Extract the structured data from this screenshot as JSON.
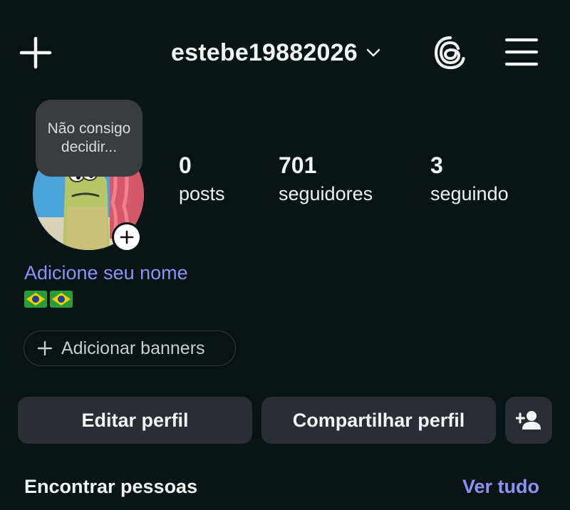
{
  "header": {
    "username": "estebe19882026",
    "icons": {
      "create": "plus-icon",
      "account_switch": "chevron-down-icon",
      "threads": "threads-icon",
      "menu": "hamburger-menu-icon"
    }
  },
  "profile": {
    "note": "Não consigo decidir...",
    "avatar_add_icon": "plus-icon",
    "stats": [
      {
        "count": "0",
        "label": "posts"
      },
      {
        "count": "701",
        "label": "seguidores"
      },
      {
        "count": "3",
        "label": "seguindo"
      }
    ],
    "add_name": "Adicione seu nome",
    "bio_emojis": "🇧🇷🇧🇷",
    "add_banners": "Adicionar banners"
  },
  "actions": {
    "edit_profile": "Editar perfil",
    "share_profile": "Compartilhar perfil",
    "discover_people_icon": "add-person-icon"
  },
  "suggestions": {
    "title": "Encontrar pessoas",
    "see_all": "Ver tudo"
  },
  "colors": {
    "background": "#0b1414",
    "accent_link": "#8a93f5",
    "button_bg": "#2a2d33"
  }
}
